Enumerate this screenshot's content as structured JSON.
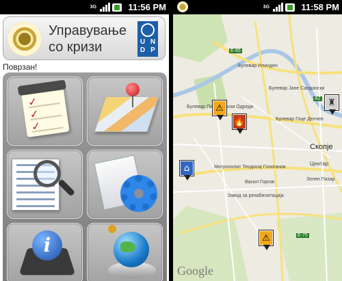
{
  "left": {
    "statusbar": {
      "network": "3G",
      "time": "11:56 PM"
    },
    "header": {
      "title": "Управување со кризи",
      "partner_letters": [
        "U",
        "N",
        "D",
        "P"
      ]
    },
    "status_text": "Поврзан!",
    "tiles": [
      {
        "name": "checklist",
        "icon": "checklist-icon"
      },
      {
        "name": "map",
        "icon": "map-pin-icon"
      },
      {
        "name": "search-documents",
        "icon": "magnifier-icon"
      },
      {
        "name": "settings",
        "icon": "gear-icon"
      },
      {
        "name": "info",
        "icon": "info-icon"
      },
      {
        "name": "globe",
        "icon": "globe-icon"
      }
    ]
  },
  "right": {
    "statusbar": {
      "network": "3G",
      "time": "11:58 PM"
    },
    "map": {
      "city_label": "Скопје",
      "district_label": "Центар",
      "labels": [
        "Булевар Илинден",
        "Булевар Партизански Одреди",
        "Булевар Гоце Делчев",
        "Булевар Јане Сандански",
        "Митрополит Теодосиј Гологанов",
        "Васил Горгов",
        "Зелен Пазар",
        "Завод за рехабилитација"
      ],
      "road_shields": [
        "E-65",
        "A2",
        "E-75"
      ],
      "attribution": "Google",
      "markers": [
        "warning",
        "fire",
        "home",
        "warning",
        "tower"
      ]
    }
  },
  "colors": {
    "undp_blue": "#1d5fa6",
    "map_bg": "#eeebe3",
    "river": "#a9c7e6",
    "road_yellow": "#f7e17a"
  }
}
